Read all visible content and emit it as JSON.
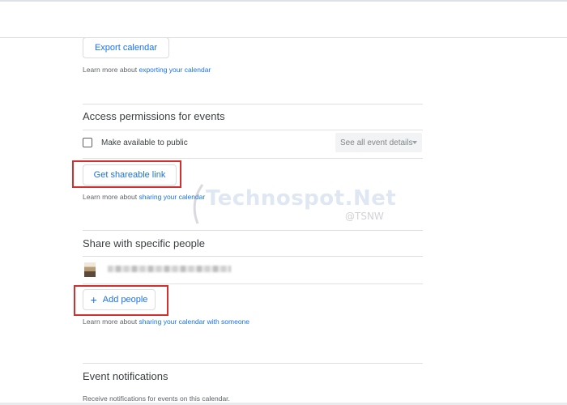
{
  "export": {
    "button": "Export calendar",
    "help_prefix": "Learn more about ",
    "help_link": "exporting your calendar"
  },
  "access": {
    "heading": "Access permissions for events",
    "public_label": "Make available to public",
    "public_checked": false,
    "details_select": "See all event details",
    "share_link_button": "Get shareable link",
    "help_prefix": "Learn more about ",
    "help_link": "sharing your calendar"
  },
  "share": {
    "heading": "Share with specific people",
    "add_people_button": "Add people",
    "help_prefix": "Learn more about ",
    "help_link": "sharing your calendar with someone"
  },
  "notifications": {
    "heading": "Event notifications",
    "desc": "Receive notifications for events on this calendar."
  },
  "watermark": {
    "text": "Technospot.Net",
    "sub": "@TSNW"
  },
  "colors": {
    "accent": "#1a73e8",
    "highlight": "#d32f2f"
  }
}
